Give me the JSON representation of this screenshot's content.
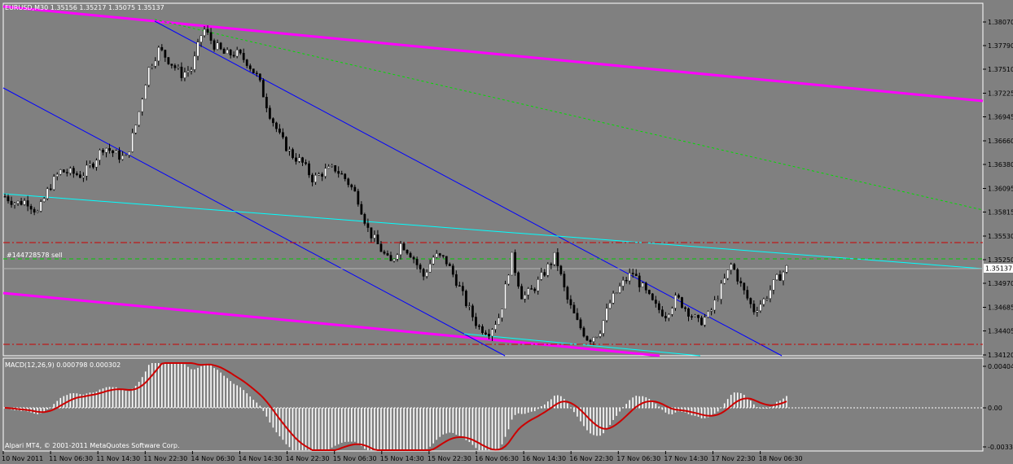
{
  "header": {
    "symbol_info": "EURUSD,M30  1.35156 1.35217 1.35075 1.35137"
  },
  "order_label": "#144728578 sell",
  "macd": {
    "label": "MACD(12,26,9) 0.000798 0.000302"
  },
  "copyright": "Alpari MT4, © 2001-2011 MetaQuotes Software Corp.",
  "colors": {
    "background": "#808080",
    "bull": "#ffffff",
    "bear": "#000000",
    "channel": "#ff00ff",
    "trend": "#0000ff",
    "support": "#00ffff",
    "signal": "#cc0000"
  },
  "chart_data": {
    "type": "candlestick",
    "price_ticks": [
      "1.38070",
      "1.37790",
      "1.37510",
      "1.37225",
      "1.36945",
      "1.36660",
      "1.36380",
      "1.36095",
      "1.35815",
      "1.35530",
      "1.35250",
      "1.34970",
      "1.34685",
      "1.34405",
      "1.34120"
    ],
    "current_price": "1.35137",
    "macd_ticks": [
      "0.00404",
      "0.00",
      "-0.00338"
    ],
    "time_ticks": [
      "10 Nov 2011",
      "11 Nov 06:30",
      "11 Nov 14:30",
      "11 Nov 22:30",
      "14 Nov 06:30",
      "14 Nov 14:30",
      "14 Nov 22:30",
      "15 Nov 06:30",
      "15 Nov 14:30",
      "15 Nov 22:30",
      "16 Nov 06:30",
      "16 Nov 14:30",
      "16 Nov 22:30",
      "17 Nov 06:30",
      "17 Nov 14:30",
      "17 Nov 22:30",
      "18 Nov 06:30"
    ],
    "close_path": [
      1.36,
      1.3592,
      1.3595,
      1.358,
      1.361,
      1.363,
      1.3628,
      1.3625,
      1.364,
      1.366,
      1.365,
      1.3645,
      1.369,
      1.375,
      1.3775,
      1.376,
      1.3745,
      1.3752,
      1.38,
      1.378,
      1.3768,
      1.377,
      1.376,
      1.374,
      1.37,
      1.367,
      1.365,
      1.364,
      1.362,
      1.363,
      1.3633,
      1.362,
      1.36,
      1.356,
      1.354,
      1.352,
      1.3545,
      1.353,
      1.3505,
      1.353,
      1.3525,
      1.35,
      1.347,
      1.3445,
      1.344,
      1.346,
      1.353,
      1.348,
      1.349,
      1.351,
      1.353,
      1.348,
      1.345,
      1.343,
      1.344,
      1.3475,
      1.3495,
      1.351,
      1.349,
      1.347,
      1.346,
      1.348,
      1.3465,
      1.345,
      1.346,
      1.349,
      1.352,
      1.349,
      1.3465,
      1.3478,
      1.35,
      1.3515
    ],
    "horizontal_levels": [
      1.3553,
      1.3525,
      1.3514,
      1.3432
    ]
  }
}
